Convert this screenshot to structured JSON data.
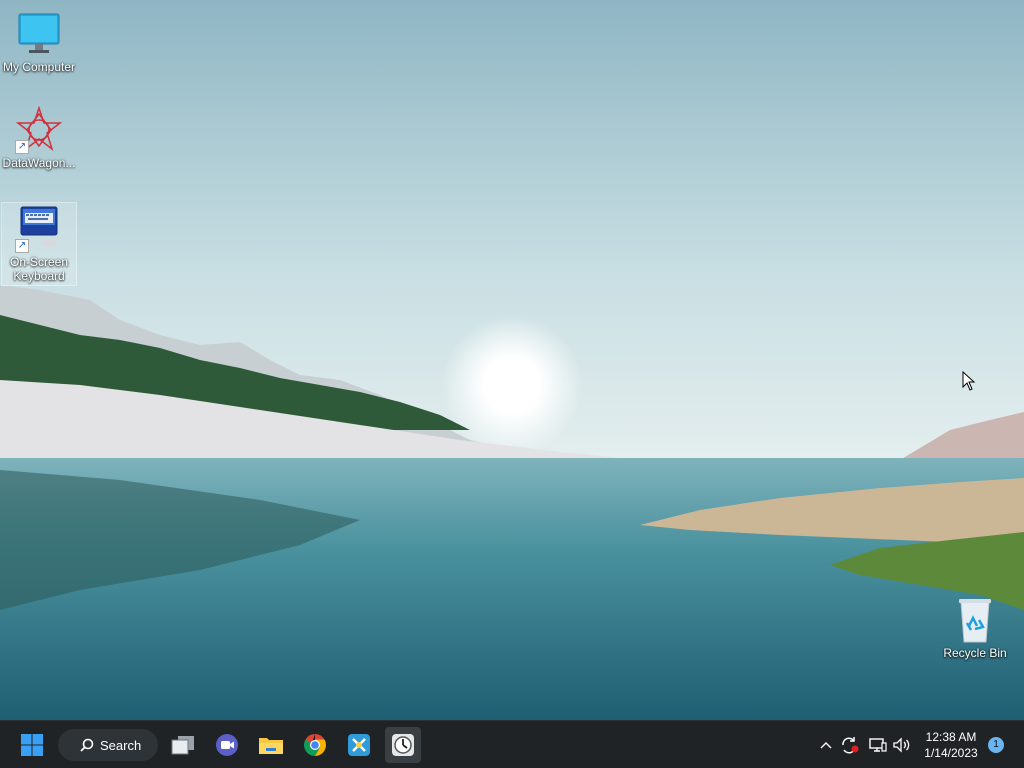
{
  "desktop": {
    "icons": [
      {
        "label": "My Computer",
        "icon": "monitor-icon"
      },
      {
        "label": "DataWagon...",
        "icon": "wolfram-star-icon"
      },
      {
        "label": "On-Screen Keyboard",
        "icon": "keyboard-icon"
      },
      {
        "label": "Recycle Bin",
        "icon": "recycle-bin-icon"
      }
    ]
  },
  "taskbar": {
    "search_label": "Search",
    "apps": [
      "start-icon",
      "task-view-icon",
      "meet-icon",
      "file-explorer-icon",
      "chrome-icon",
      "tool-app-icon",
      "clock-app-icon"
    ],
    "tray": {
      "time": "12:38 AM",
      "date": "1/14/2023",
      "notification_count": "1"
    }
  },
  "colors": {
    "taskbar_bg": "#1f2326",
    "accent": "#0078d4"
  }
}
